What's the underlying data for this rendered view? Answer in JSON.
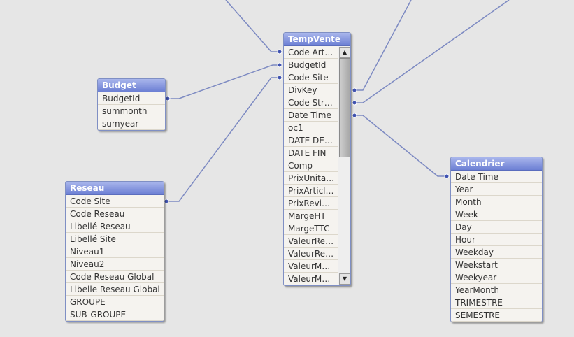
{
  "colors": {
    "link": "#7d8ac2",
    "dot": "#3f52b0",
    "header": "#7f8fd8"
  },
  "tables": {
    "budget": {
      "title": "Budget",
      "fields": [
        "BudgetId",
        "summonth",
        "sumyear"
      ]
    },
    "reseau": {
      "title": "Reseau",
      "fields": [
        "Code Site",
        "Code Reseau",
        "Libellé Reseau",
        "Libellé Site",
        "Niveau1",
        "Niveau2",
        "Code Reseau Global",
        "Libelle Reseau Global",
        "GROUPE",
        "SUB-GROUPE"
      ]
    },
    "tempvente": {
      "title": "TempVente",
      "fields": [
        "Code Art…",
        "BudgetId",
        "Code Site",
        "DivKey",
        "Code Str…",
        "Date Time",
        "oc1",
        "DATE DE…",
        "DATE FIN",
        "Comp",
        "PrixUnita…",
        "PrixArticl…",
        "PrixRevi…",
        "MargeHT",
        "MargeTTC",
        "ValeurRe…",
        "ValeurRe…",
        "ValeurM…",
        "ValeurM…"
      ]
    },
    "calendrier": {
      "title": "Calendrier",
      "fields": [
        "Date Time",
        "Year",
        "Month",
        "Week",
        "Day",
        "Hour",
        "Weekday",
        "Weekstart",
        "Weekyear",
        "YearMonth",
        "TRIMESTRE",
        "SEMESTRE"
      ]
    }
  },
  "scrollbar": {
    "up_icon": "triangle-up",
    "down_icon": "triangle-down"
  }
}
